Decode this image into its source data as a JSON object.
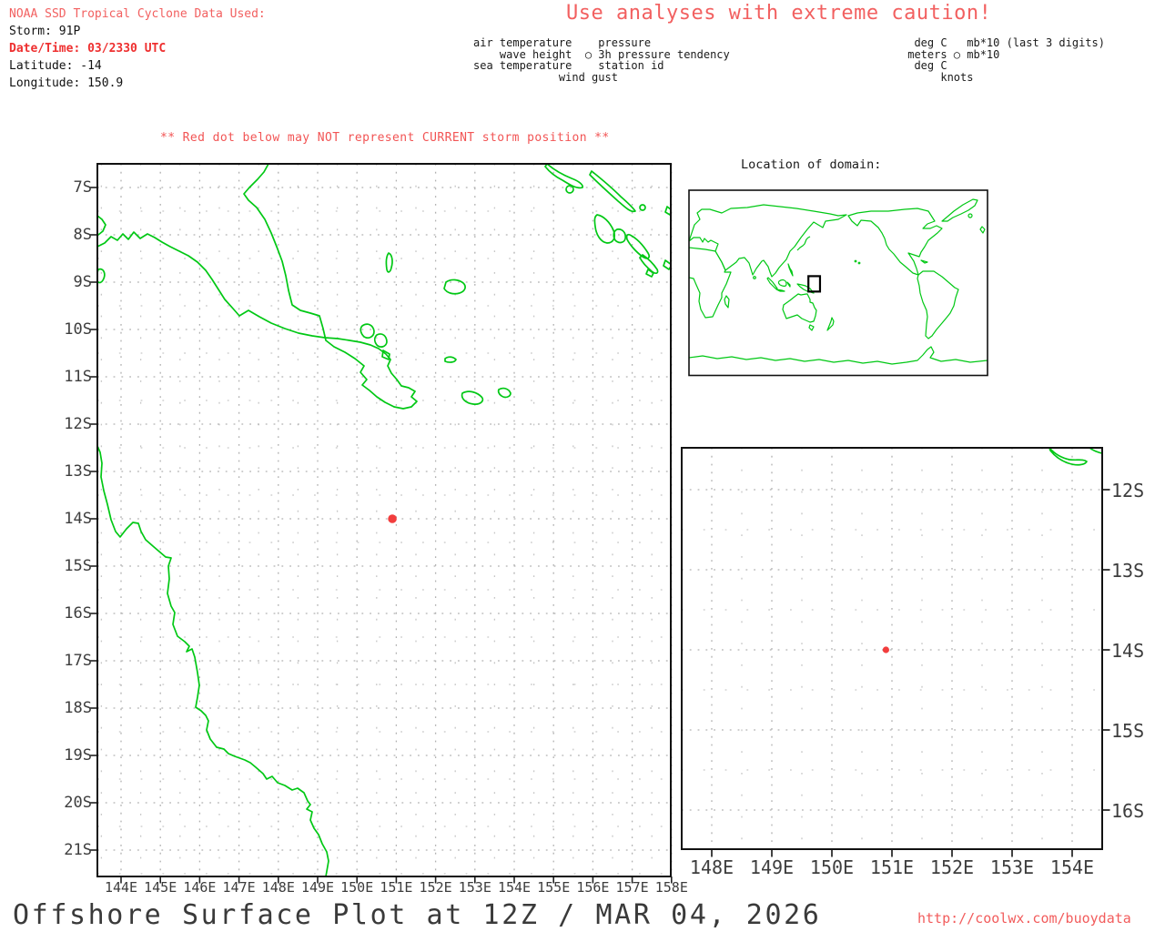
{
  "header": {
    "source_label": "NOAA SSD Tropical Cyclone Data Used:",
    "storm_line": "Storm: 91P",
    "datetime_line": "Date/Time: 03/2330 UTC",
    "latitude_line": "Latitude: -14",
    "longitude_line": "Longitude: 150.9",
    "caution": "Use analyses with extreme caution!"
  },
  "station_legend": {
    "lines": [
      "air temperature    pressure",
      "    wave height  ○ 3h pressure tendency",
      "sea temperature    station id",
      "             wind gust"
    ]
  },
  "units_legend": {
    "lines": [
      "  deg C   mb*10 (last 3 digits)",
      " meters ○ mb*10",
      "  deg C",
      "      knots"
    ]
  },
  "warning": "** Red dot below may NOT represent CURRENT storm position **",
  "inset_title": "Location of domain:",
  "footer": {
    "title": "Offshore Surface Plot at 12Z / MAR 04, 2026",
    "url": "http://coolwx.com/buoydata"
  },
  "storm": {
    "id": "91P",
    "lon": 150.9,
    "lat": -14
  },
  "colors": {
    "coast_green": "#00c814",
    "storm_red": "#f23d3d",
    "salmon_red": "#f26060",
    "bold_red": "#ee2f2f",
    "grid_gray": "#b0b0b0",
    "grid_gray_light": "#c6c6c6",
    "axis_text": "#3d3d3d",
    "frame_black": "#111111"
  },
  "chart_data": {
    "type": "scatter",
    "title": "Offshore Surface Plot at 12Z / MAR 04, 2026",
    "maps": [
      {
        "name": "main_map",
        "lon_ticks": [
          "144E",
          "145E",
          "146E",
          "147E",
          "148E",
          "149E",
          "150E",
          "151E",
          "152E",
          "153E",
          "154E",
          "155E",
          "156E",
          "157E",
          "158E"
        ],
        "lat_ticks": [
          "7S",
          "8S",
          "9S",
          "10S",
          "11S",
          "12S",
          "13S",
          "14S",
          "15S",
          "16S",
          "17S",
          "18S",
          "19S",
          "20S",
          "21S"
        ],
        "lon_range": [
          143.4,
          158.0
        ],
        "lat_range": [
          -21.6,
          -6.5
        ],
        "grid": "dotted 1-degree with faint half-degree",
        "points": [
          {
            "label": "storm 91P",
            "lon": 150.9,
            "lat": -14
          }
        ]
      },
      {
        "name": "location_inset",
        "title": "Location of domain:",
        "lon_range": [
          0,
          360
        ],
        "lat_range": [
          -90,
          90
        ],
        "domain_box_lon": [
          144,
          158
        ],
        "domain_box_lat": [
          -21.5,
          -6.5
        ]
      },
      {
        "name": "zoom_inset",
        "lon_ticks": [
          "148E",
          "149E",
          "150E",
          "151E",
          "152E",
          "153E",
          "154E"
        ],
        "lat_ticks": [
          "12S",
          "13S",
          "14S",
          "15S",
          "16S"
        ],
        "lon_range": [
          147.5,
          154.5
        ],
        "lat_range": [
          -16.5,
          -11.5
        ],
        "points": [
          {
            "label": "storm 91P",
            "lon": 150.9,
            "lat": -14
          }
        ]
      }
    ]
  }
}
